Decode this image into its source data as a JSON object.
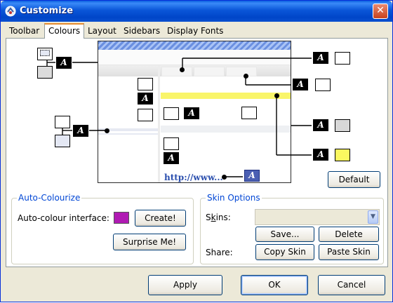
{
  "window": {
    "title": "Customize",
    "close_glyph": "✕"
  },
  "tabs": [
    {
      "label": "Toolbar",
      "active": false
    },
    {
      "label": "Colours",
      "active": true
    },
    {
      "label": "Layout",
      "active": false
    },
    {
      "label": "Sidebars",
      "active": false
    },
    {
      "label": "Display Fonts",
      "active": false
    }
  ],
  "preview": {
    "url_text": "http://www...",
    "a_glyph": "A",
    "swatch_colors": {
      "light_gray": "#d8d8d8",
      "yellow": "#fbf860",
      "lavender": "#e4e8f4",
      "gray_box": "#dcdcdc"
    }
  },
  "buttons": {
    "default": "Default",
    "apply": "Apply",
    "ok": "OK",
    "cancel": "Cancel"
  },
  "auto_colourize": {
    "title": "Auto-Colourize",
    "label": "Auto-colour interface:",
    "swatch_color": "#b01ab3",
    "create_label": "Create!",
    "surprise_label": "Surprise Me!"
  },
  "skin_options": {
    "title": "Skin Options",
    "skins_label_pre": "S",
    "skins_label_u": "k",
    "skins_label_post": "ins:",
    "skins_value": "",
    "save_label": "Save...",
    "delete_label": "Delete",
    "share_label": "Share:",
    "copy_label": "Copy Skin",
    "paste_label": "Paste Skin"
  },
  "icons": {
    "title": "opera-icon",
    "combo": "chevron-down-icon"
  },
  "colors": {
    "accent": "#0046d5",
    "title_bar": "#0a56d8",
    "tab_highlight": "#e68b2c"
  }
}
